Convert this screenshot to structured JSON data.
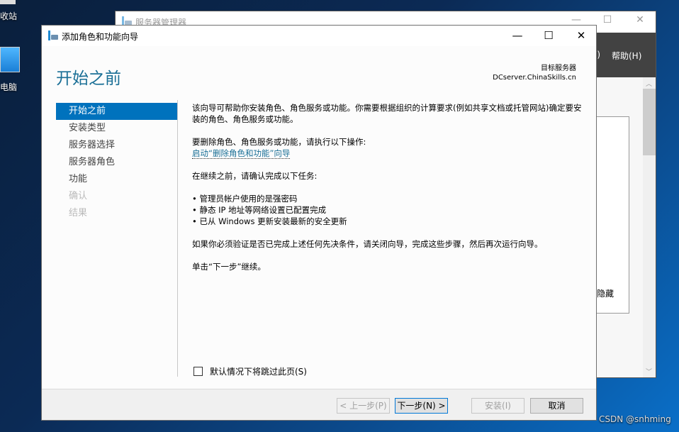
{
  "desktop": {
    "icons": [
      {
        "label": "回收站"
      },
      {
        "label": "此电脑"
      }
    ],
    "watermark": "CSDN @snhming"
  },
  "server_manager": {
    "title": "服务器管理器",
    "menu": [
      "Y)",
      "帮助(H)"
    ],
    "panel_text": "隐藏"
  },
  "wizard": {
    "title": "添加角色和功能向导",
    "page_title": "开始之前",
    "target_label": "目标服务器",
    "target_server": "DCserver.ChinaSkills.cn",
    "nav": [
      {
        "label": "开始之前",
        "state": "selected"
      },
      {
        "label": "安装类型",
        "state": "enabled"
      },
      {
        "label": "服务器选择",
        "state": "enabled"
      },
      {
        "label": "服务器角色",
        "state": "enabled"
      },
      {
        "label": "功能",
        "state": "enabled"
      },
      {
        "label": "确认",
        "state": "disabled"
      },
      {
        "label": "结果",
        "state": "disabled"
      }
    ],
    "content": {
      "intro": "该向导可帮助你安装角色、角色服务或功能。你需要根据组织的计算要求(例如共享文档或托管网站)确定要安装的角色、角色服务或功能。",
      "remove_text": "要删除角色、角色服务或功能，请执行以下操作:",
      "remove_link": "启动“删除角色和功能”向导",
      "before_text": "在继续之前，请确认完成以下任务:",
      "tasks": [
        "管理员帐户使用的是强密码",
        "静态 IP 地址等网络设置已配置完成",
        "已从 Windows 更新安装最新的安全更新"
      ],
      "verify_text": "如果你必须验证是否已完成上述任何先决条件，请关闭向导，完成这些步骤，然后再次运行向导。",
      "next_text": "单击“下一步”继续。"
    },
    "skip_label": "默认情况下将跳过此页(S)",
    "skip_checked": false,
    "buttons": {
      "prev": "< 上一步(P)",
      "next": "下一步(N) >",
      "install": "安装(I)",
      "cancel": "取消"
    },
    "accent": "#0072bd"
  }
}
